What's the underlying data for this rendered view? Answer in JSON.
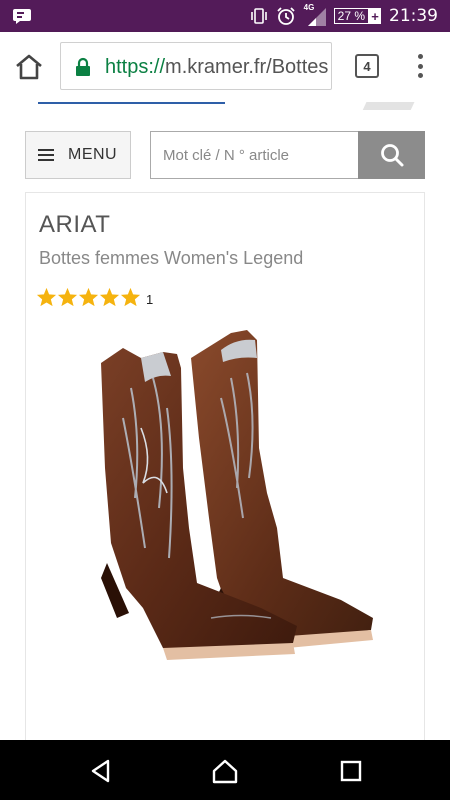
{
  "status_bar": {
    "time": "21:39",
    "battery": "27 %",
    "network": "4G",
    "background_color": "#531b59"
  },
  "browser": {
    "url_scheme": "https://",
    "url_rest": "m.kramer.fr/Bottes",
    "tab_count": "4",
    "icons": [
      "home-icon",
      "lock-icon",
      "more-vert-icon"
    ]
  },
  "header": {
    "menu_label": "MENU",
    "search_placeholder": "Mot clé / N ° article"
  },
  "product": {
    "brand": "ARIAT",
    "name": "Bottes femmes Women's Legend",
    "rating": 5,
    "rating_max": 5,
    "review_count": "1",
    "star_color": "#f5b30f"
  },
  "nav": {
    "icons": [
      "back-icon",
      "home-icon",
      "recents-icon"
    ]
  }
}
